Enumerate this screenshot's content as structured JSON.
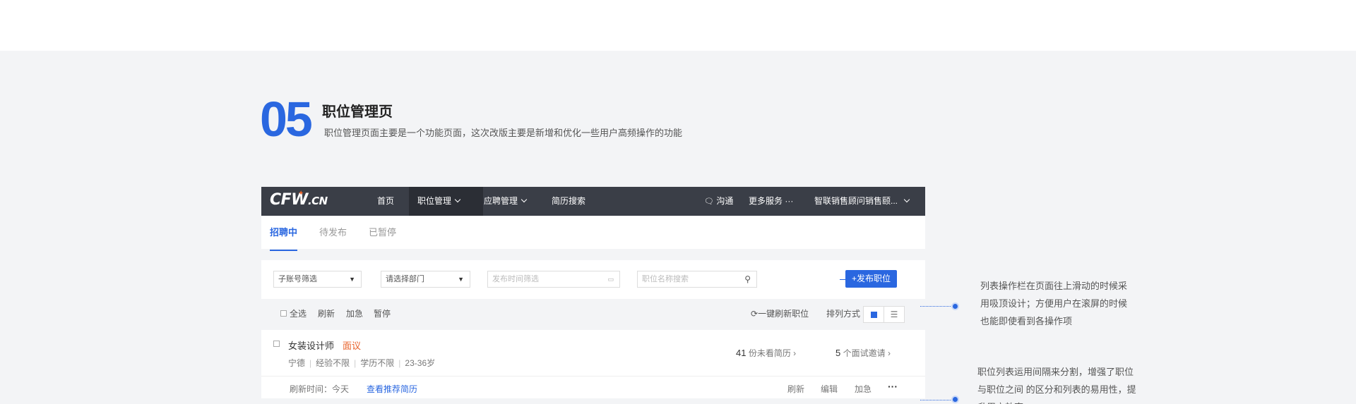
{
  "section": {
    "number": "05",
    "title": "职位管理页",
    "description": "职位管理页面主要是一个功能页面，这次改版主要是新增和优化一些用户高频操作的功能"
  },
  "app": {
    "logo": "CFW",
    "logo_suffix": ".CN",
    "nav": [
      "首页",
      "职位管理",
      "应聘管理",
      "简历搜索"
    ],
    "nav_right": {
      "chat": "沟通",
      "more": "更多服务",
      "user": "智联销售顾问销售颐..."
    },
    "tabs": [
      "招聘中",
      "待发布",
      "已暂停"
    ],
    "filters": {
      "account": "子账号筛选",
      "department": "请选择部门",
      "date_placeholder": "发布时间筛选",
      "search_placeholder": "职位名称搜索",
      "publish": "+发布职位"
    },
    "actions": {
      "select_all": "全选",
      "refresh": "刷新",
      "urgent": "加急",
      "pause": "暂停",
      "refresh_all": "一键刷新职位",
      "sort": "排列方式"
    },
    "job": {
      "title": "女装设计师",
      "salary": "面议",
      "city": "宁德",
      "experience": "经验不限",
      "education": "学历不限",
      "age": "23-36岁",
      "unread_count": "41",
      "unread_label": "份未看简历",
      "interview_count": "5",
      "interview_label": "个面试邀请",
      "refresh_time": "刷新时间：今天",
      "view_recommended": "查看推荐简历",
      "refresh": "刷新",
      "edit": "编辑",
      "urgent": "加急",
      "more": "···"
    }
  },
  "notes": [
    [
      "列表操作栏在页面往上滑动的时候采",
      "用吸顶设计；方便用户在滚屏的时候",
      "也能即使看到各操作项"
    ],
    [
      "职位列表运用间隔来分割，增强了职位",
      "与职位之间 的区分和列表的易用性，提",
      "升用户效率"
    ]
  ],
  "colors": {
    "accent": "#2a67e0",
    "nav_bg": "#3a3e47",
    "salary": "#e8632b",
    "page_bg": "#f3f4f6"
  }
}
